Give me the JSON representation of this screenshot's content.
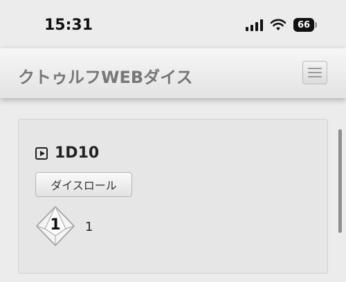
{
  "status_bar": {
    "time": "15:31",
    "battery": "66"
  },
  "navbar": {
    "brand": "クトゥルフWEBダイス"
  },
  "dice_panel": {
    "title": "1D10",
    "roll_label": "ダイスロール",
    "die_face": "1",
    "result": "1"
  },
  "colors": {
    "background": "#ececec",
    "brand_text": "#777777",
    "card_bg": "#e6e6e6"
  },
  "icons": [
    "cellular-signal-icon",
    "wifi-icon",
    "battery-icon",
    "hamburger-menu-icon",
    "play-square-icon",
    "d10-die-icon"
  ]
}
